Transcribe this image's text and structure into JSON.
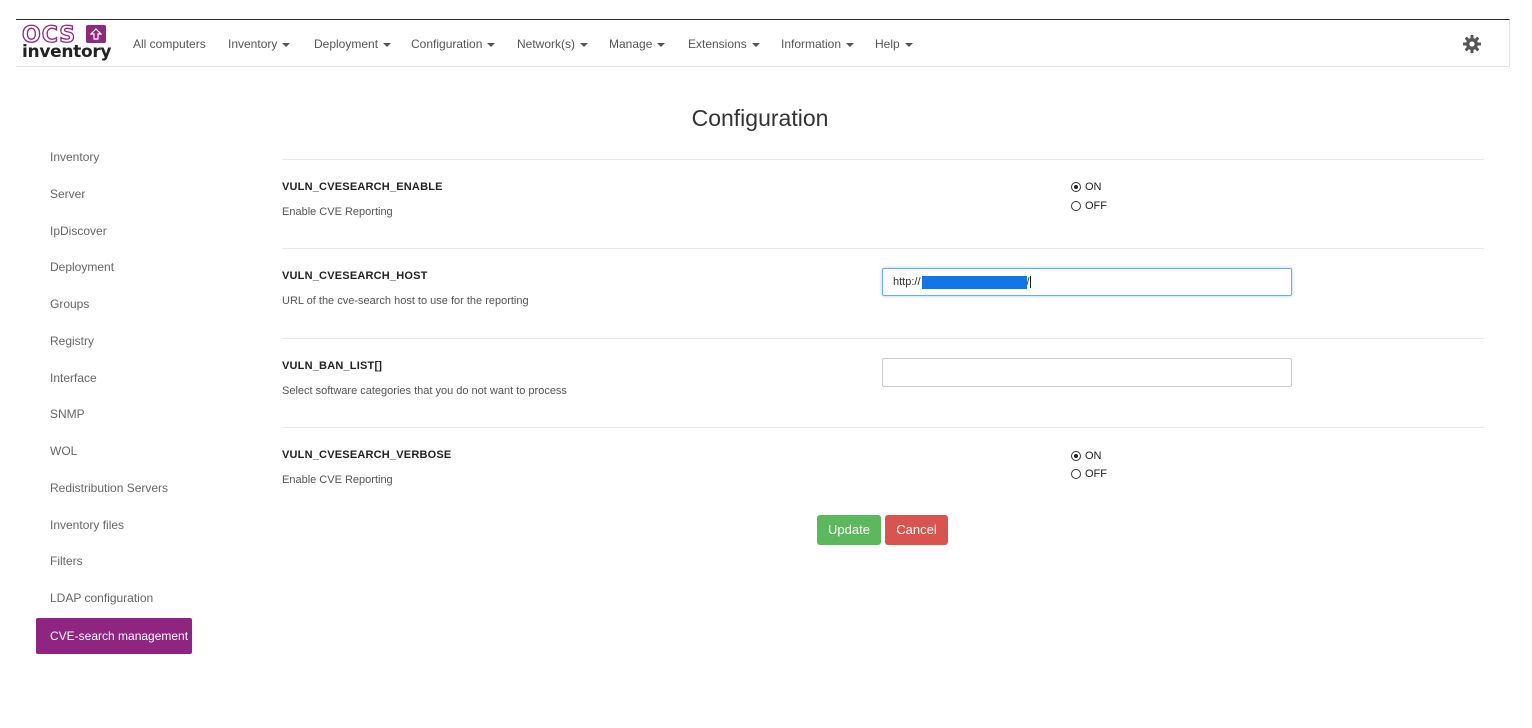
{
  "logo": {
    "top": "OCS",
    "bottom": "inventory"
  },
  "nav": {
    "items": [
      {
        "label": "All computers"
      },
      {
        "label": "Inventory"
      },
      {
        "label": "Deployment"
      },
      {
        "label": "Configuration"
      },
      {
        "label": "Network(s)"
      },
      {
        "label": "Manage"
      },
      {
        "label": "Extensions"
      },
      {
        "label": "Information"
      },
      {
        "label": "Help"
      }
    ],
    "settings_icon": "gear-icon"
  },
  "page": {
    "title": "Configuration"
  },
  "sidebar": {
    "items": [
      {
        "label": "Inventory"
      },
      {
        "label": "Server"
      },
      {
        "label": "IpDiscover"
      },
      {
        "label": "Deployment"
      },
      {
        "label": "Groups"
      },
      {
        "label": "Registry"
      },
      {
        "label": "Interface"
      },
      {
        "label": "SNMP"
      },
      {
        "label": "WOL"
      },
      {
        "label": "Redistribution Servers"
      },
      {
        "label": "Inventory files"
      },
      {
        "label": "Filters"
      },
      {
        "label": "LDAP configuration"
      },
      {
        "label": "CVE-search management",
        "active": true
      }
    ]
  },
  "settings": {
    "enable": {
      "key": "VULN_CVESEARCH_ENABLE",
      "desc": "Enable CVE Reporting",
      "on": "ON",
      "off": "OFF",
      "value": "ON"
    },
    "host": {
      "key": "VULN_CVESEARCH_HOST",
      "desc": "URL of the cve-search host to use for the reporting",
      "prefix": "http://",
      "suffix": "/"
    },
    "ban": {
      "key": "VULN_BAN_LIST[]",
      "desc": "Select software categories that you do not want to process",
      "value": ""
    },
    "verbose": {
      "key": "VULN_CVESEARCH_VERBOSE",
      "desc": "Enable CVE Reporting",
      "on": "ON",
      "off": "OFF",
      "value": "ON"
    }
  },
  "buttons": {
    "update": "Update",
    "cancel": "Cancel"
  },
  "colors": {
    "brand": "#8f2580",
    "update": "#5cb85c",
    "cancel": "#d9534f",
    "selection": "#1177e6"
  }
}
